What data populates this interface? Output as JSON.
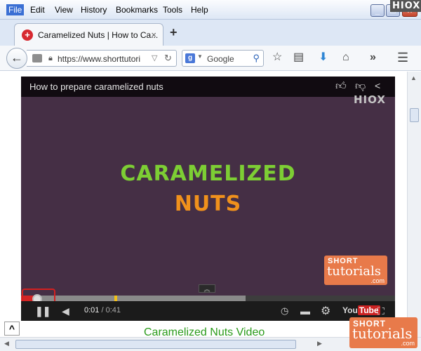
{
  "menubar": {
    "items": [
      "File",
      "Edit",
      "View",
      "History",
      "Bookmarks",
      "Tools",
      "Help"
    ],
    "corner_brand": "HIOX"
  },
  "tab": {
    "title": "Caramelized Nuts | How to Ca...",
    "close": "×",
    "new_tab": "+"
  },
  "nav": {
    "url": "https://www.shorttutori",
    "search_placeholder": "Google",
    "search_engine_letter": "g"
  },
  "video": {
    "title": "How to prepare caramelized nuts",
    "watermark": "HIOX",
    "caption_line1": "CARAMELIZED",
    "caption_line2": "NUTS",
    "logo_short": "SHORT",
    "logo_tutorials": "tutorials",
    "logo_com": ".com",
    "current_time": "0:01",
    "total_time": "/ 0:41",
    "youtube": "You",
    "youtube_tube": "Tube",
    "played_fraction": 0.04,
    "loaded_fraction": 0.6
  },
  "page": {
    "heading": "Caramelized Nuts Video"
  },
  "corner_logo": {
    "short": "SHORT",
    "tutorials": "tutorials",
    "com": ".com"
  },
  "icons": [
    "back-arrow-icon",
    "lock-icon",
    "reload-icon",
    "search-icon",
    "bookmark-star-icon",
    "reading-list-icon",
    "download-icon",
    "home-icon",
    "overflow-icon",
    "hamburger-menu-icon",
    "thumbs-up-icon",
    "thumbs-down-icon",
    "share-icon",
    "pause-icon",
    "volume-icon",
    "clock-icon",
    "captions-icon",
    "gear-icon",
    "fullscreen-icon",
    "chevron-up-icon"
  ]
}
